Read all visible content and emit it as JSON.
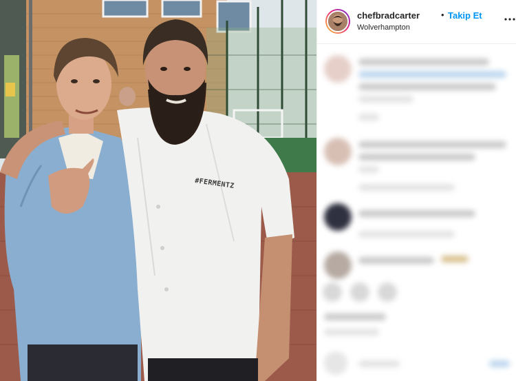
{
  "header": {
    "username": "chefbradcarter",
    "separator": "•",
    "follow_label": "Takip Et",
    "location": "Wolverhampton",
    "more_icon": "more-horizontal-icon"
  },
  "photo": {
    "shirt_logo": "#FERMENTZ"
  },
  "colors": {
    "follow_blue": "#0095f6",
    "text": "#262626",
    "divider": "#efefef"
  }
}
